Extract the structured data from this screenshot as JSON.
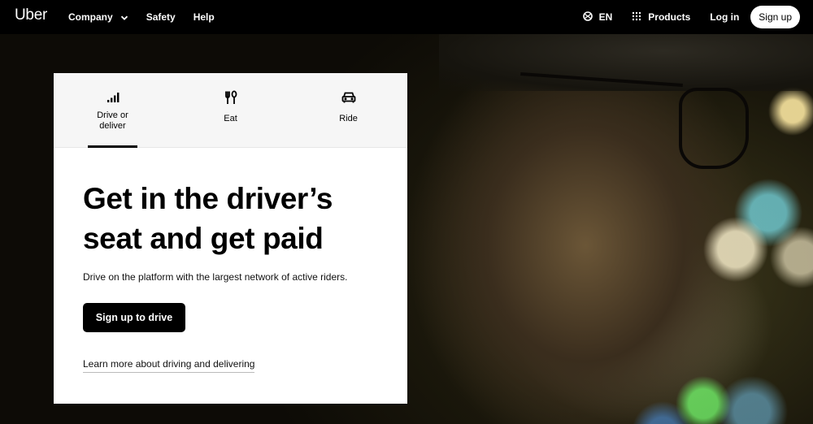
{
  "nav": {
    "logo": "Uber",
    "left_links": [
      {
        "label": "Company",
        "icon": "chevron-down-icon"
      },
      {
        "label": "Safety"
      },
      {
        "label": "Help"
      }
    ],
    "language": {
      "label": "EN",
      "icon": "globe-icon"
    },
    "products": {
      "label": "Products",
      "icon": "grid-icon"
    },
    "login_label": "Log in",
    "signup_label": "Sign up"
  },
  "card": {
    "tabs": [
      {
        "label": "Drive or deliver",
        "icon": "signal-bars-icon",
        "selected": true
      },
      {
        "label": "Eat",
        "icon": "fork-knife-icon",
        "selected": false
      },
      {
        "label": "Ride",
        "icon": "car-icon",
        "selected": false
      }
    ],
    "headline": "Get in the driver’s seat and get paid",
    "subtext": "Drive on the platform with the largest network of active riders.",
    "cta_label": "Sign up to drive",
    "learn_more": "Learn more about driving and delivering"
  },
  "colors": {
    "nav_bg": "#000000",
    "card_bg": "#ffffff",
    "tabs_bg": "#f6f6f6",
    "accent": "#000000"
  }
}
